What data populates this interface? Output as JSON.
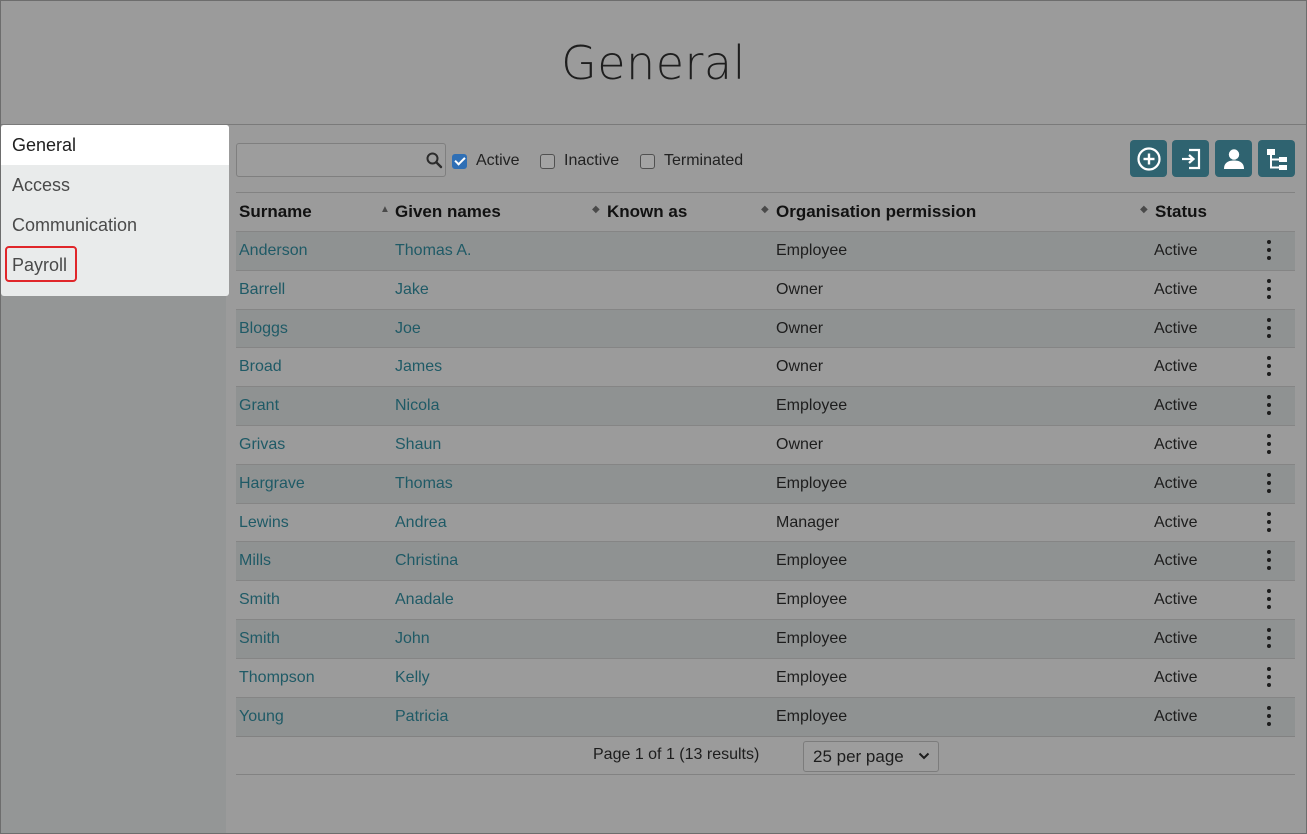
{
  "page": {
    "title": "General"
  },
  "sidebar": {
    "items": [
      {
        "label": "General"
      },
      {
        "label": "Access"
      },
      {
        "label": "Communication"
      },
      {
        "label": "Payroll"
      }
    ]
  },
  "search": {
    "placeholder": "",
    "value": ""
  },
  "filters": [
    {
      "label": "Active",
      "checked": true
    },
    {
      "label": "Inactive",
      "checked": false
    },
    {
      "label": "Terminated",
      "checked": false
    }
  ],
  "toolbar": {
    "buttons": [
      {
        "icon": "add-circle-icon"
      },
      {
        "icon": "import-icon"
      },
      {
        "icon": "person-icon"
      },
      {
        "icon": "org-chart-icon"
      }
    ],
    "color": "#2f6370"
  },
  "table": {
    "columns": [
      {
        "label": "Surname"
      },
      {
        "label": "Given names",
        "sort": "asc"
      },
      {
        "label": "Known as"
      },
      {
        "label": "Organisation permission"
      },
      {
        "label": "Status"
      }
    ],
    "rows": [
      {
        "surname": "Anderson",
        "given": "Thomas A.",
        "known": "",
        "permission": "Employee",
        "status": "Active"
      },
      {
        "surname": "Barrell",
        "given": "Jake",
        "known": "",
        "permission": "Owner",
        "status": "Active"
      },
      {
        "surname": "Bloggs",
        "given": "Joe",
        "known": "",
        "permission": "Owner",
        "status": "Active"
      },
      {
        "surname": "Broad",
        "given": "James",
        "known": "",
        "permission": "Owner",
        "status": "Active"
      },
      {
        "surname": "Grant",
        "given": "Nicola",
        "known": "",
        "permission": "Employee",
        "status": "Active"
      },
      {
        "surname": "Grivas",
        "given": "Shaun",
        "known": "",
        "permission": "Owner",
        "status": "Active"
      },
      {
        "surname": "Hargrave",
        "given": "Thomas",
        "known": "",
        "permission": "Employee",
        "status": "Active"
      },
      {
        "surname": "Lewins",
        "given": "Andrea",
        "known": "",
        "permission": "Manager",
        "status": "Active"
      },
      {
        "surname": "Mills",
        "given": "Christina",
        "known": "",
        "permission": "Employee",
        "status": "Active"
      },
      {
        "surname": "Smith",
        "given": "Anadale",
        "known": "",
        "permission": "Employee",
        "status": "Active"
      },
      {
        "surname": "Smith",
        "given": "John",
        "known": "",
        "permission": "Employee",
        "status": "Active"
      },
      {
        "surname": "Thompson",
        "given": "Kelly",
        "known": "",
        "permission": "Employee",
        "status": "Active"
      },
      {
        "surname": "Young",
        "given": "Patricia",
        "known": "",
        "permission": "Employee",
        "status": "Active"
      }
    ]
  },
  "pagination": {
    "text": "Page 1 of 1 (13 results)",
    "per_page": "25 per page"
  },
  "colors": {
    "link": "#1f5a66",
    "highlight": "#e0262a",
    "checkbox": "#2f6fb5"
  }
}
